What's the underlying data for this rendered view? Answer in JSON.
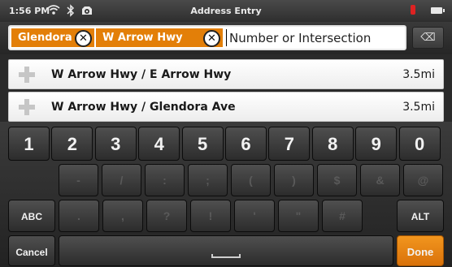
{
  "status_bar": {
    "time": "1:56 PM",
    "title": "Address Entry",
    "icons": [
      "wifi-icon",
      "bluetooth-icon",
      "gps-icon",
      "alert-icon",
      "battery-icon"
    ]
  },
  "address_input": {
    "chips": [
      {
        "label": "Glendora",
        "remove_glyph": "✕"
      },
      {
        "label": "W Arrow Hwy",
        "remove_glyph": "✕"
      }
    ],
    "placeholder": "Number or Intersection",
    "value": "",
    "backspace_glyph": "⌫"
  },
  "results": [
    {
      "label": "W Arrow Hwy / E Arrow Hwy",
      "distance": "3.5mi",
      "icon": "intersection-icon"
    },
    {
      "label": "W Arrow Hwy / Glendora Ave",
      "distance": "3.5mi",
      "icon": "intersection-icon"
    }
  ],
  "keyboard": {
    "number_row": [
      "1",
      "2",
      "3",
      "4",
      "5",
      "6",
      "7",
      "8",
      "9",
      "0"
    ],
    "symbol_row_1": [
      "-",
      "/",
      ":",
      ";",
      "(",
      ")",
      "$",
      "&",
      "@"
    ],
    "symbol_row_2": [
      ".",
      ",",
      "?",
      "!",
      "'",
      "\"",
      "#"
    ],
    "abc_label": "ABC",
    "alt_label": "ALT",
    "cancel_label": "Cancel",
    "done_label": "Done",
    "accent_color": "#e37f08"
  }
}
